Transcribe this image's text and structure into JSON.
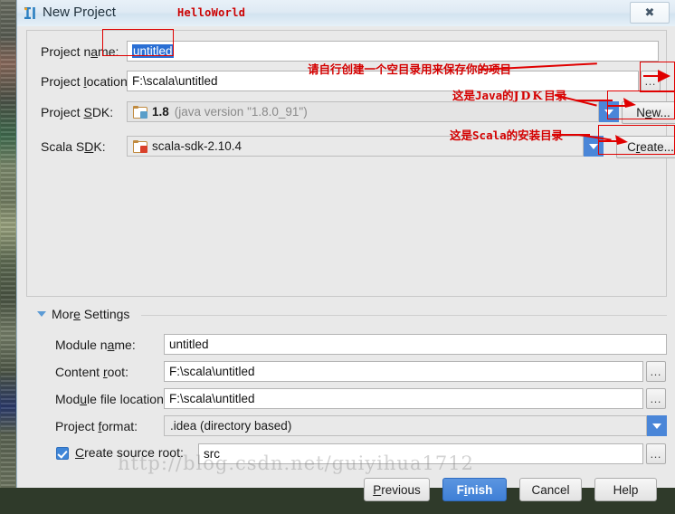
{
  "window": {
    "title": "New Project",
    "title_icon": "intellij-idea-icon",
    "close_label": "✖",
    "header_note": "HelloWorld"
  },
  "form": {
    "project_name": {
      "label_pre": "Project n",
      "label_accel": "a",
      "label_post": "me:",
      "value": "untitled"
    },
    "project_location": {
      "label_pre": "Project ",
      "label_accel": "l",
      "label_post": "ocation:",
      "value": "F:\\scala\\untitled",
      "browse_label": "…"
    },
    "project_sdk": {
      "label_pre": "Project ",
      "label_accel": "S",
      "label_post": "DK:",
      "value": "1.8",
      "value_suffix": "(java version \"1.8.0_91\")",
      "icon": "java-folder-icon",
      "new_button": {
        "pre": "N",
        "accel": "e",
        "post": "w..."
      }
    },
    "scala_sdk": {
      "label_pre": "Scala S",
      "label_accel": "D",
      "label_post": "K:",
      "value": "scala-sdk-2.10.4",
      "icon": "scala-folder-icon",
      "create_button": {
        "pre": "C",
        "accel": "r",
        "post": "eate..."
      }
    }
  },
  "more_settings": {
    "header": "More Settings",
    "header_pre": "Mor",
    "header_accel": "e",
    "header_post": " Settings",
    "module_name": {
      "label_pre": "Module n",
      "label_accel": "a",
      "label_post": "me:",
      "value": "untitled"
    },
    "content_root": {
      "label_pre": "Content ",
      "label_accel": "r",
      "label_post": "oot:",
      "value": "F:\\scala\\untitled",
      "browse_label": "…"
    },
    "module_file_location": {
      "label_pre": "Mod",
      "label_accel": "u",
      "label_post": "le file location:",
      "value": "F:\\scala\\untitled",
      "browse_label": "…"
    },
    "project_format": {
      "label_pre": "Project ",
      "label_accel": "f",
      "label_post": "ormat:",
      "value": ".idea (directory based)"
    },
    "create_source_root": {
      "label_pre": "",
      "label_accel": "C",
      "label_post": "reate source root:",
      "checked": true,
      "value": "src",
      "browse_label": "…"
    }
  },
  "footer": {
    "previous": {
      "pre": "",
      "accel": "P",
      "post": "revious"
    },
    "finish": {
      "pre": "F",
      "accel": "i",
      "post": "nish"
    },
    "cancel": {
      "pre": "Cancel",
      "accel": "",
      "post": ""
    },
    "help": {
      "pre": "Help",
      "accel": "",
      "post": ""
    }
  },
  "annotations": {
    "project_location_note": "请自行创建一个空目录用来保存你的项目",
    "java_sdk_note_a": "这是",
    "java_sdk_note_b": "Java",
    "java_sdk_note_c": "的",
    "java_sdk_note_d": "JDK",
    "java_sdk_note_e": "目录",
    "scala_sdk_note_a": "这是",
    "scala_sdk_note_b": "Scala",
    "scala_sdk_note_c": "的安装目录"
  },
  "watermark": {
    "text": "http://blog.csdn.net/guiyihua1712"
  },
  "colors": {
    "accent_blue": "#3f7fd6",
    "combo_arrow_blue": "#4a86d8",
    "annotation_red": "#d40000",
    "selection_blue": "#2a6fd4",
    "dialog_bg": "#e9e9e9"
  }
}
